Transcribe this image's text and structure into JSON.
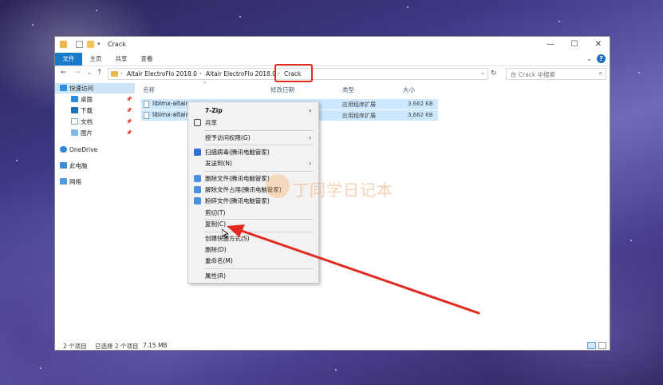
{
  "window": {
    "title": "Crack",
    "controls": {
      "minimize": "—",
      "maximize": "☐",
      "close": "✕"
    }
  },
  "ribbon": {
    "tabs": [
      "文件",
      "主页",
      "共享",
      "查看"
    ],
    "collapse_icon": "chevron-down-icon",
    "help_label": "?"
  },
  "address": {
    "crumbs": [
      "Altair ElectroFlo 2018.0",
      "Altair ElectroFlo 2018.0",
      "Crack"
    ],
    "search_placeholder": "在 Crack 中搜索"
  },
  "nav": {
    "items": [
      {
        "label": "快速访问",
        "icon": "star-icon",
        "pinned": false
      },
      {
        "label": "桌面",
        "icon": "desktop-icon",
        "pinned": true
      },
      {
        "label": "下载",
        "icon": "download-icon",
        "pinned": true
      },
      {
        "label": "文档",
        "icon": "document-icon",
        "pinned": true
      },
      {
        "label": "图片",
        "icon": "picture-icon",
        "pinned": true
      },
      {
        "label": "OneDrive",
        "icon": "cloud-icon",
        "pinned": false
      },
      {
        "label": "此电脑",
        "icon": "computer-icon",
        "pinned": false
      },
      {
        "label": "网络",
        "icon": "network-icon",
        "pinned": false
      }
    ]
  },
  "columns": {
    "name": "名称",
    "modified": "修改日期",
    "type": "类型",
    "size": "大小"
  },
  "files": [
    {
      "name": "liblmx-altair...",
      "type": "应用程序扩展",
      "size": "3,662 KB"
    },
    {
      "name": "liblmx-altair...",
      "type": "应用程序扩展",
      "size": "3,662 KB"
    }
  ],
  "context_menu": {
    "items": [
      {
        "label": "7-Zip",
        "bold": true,
        "submenu": true
      },
      {
        "label": "共享",
        "icon": "share-icon"
      },
      {
        "label": "授予访问权限(G)",
        "submenu": true
      },
      {
        "label": "扫描病毒(腾讯电脑管家)",
        "icon": "shield-icon"
      },
      {
        "label": "发送到(N)",
        "submenu": true
      },
      {
        "label": "删除文件(腾讯电脑管家)",
        "icon": "delete-file-icon"
      },
      {
        "label": "解除文件占用(腾讯电脑管家)",
        "icon": "unlock-file-icon"
      },
      {
        "label": "粉碎文件(腾讯电脑管家)",
        "icon": "shred-file-icon"
      },
      {
        "label": "剪切(T)"
      },
      {
        "label": "复制(C)"
      },
      {
        "label": "创建快捷方式(S)"
      },
      {
        "label": "删除(D)"
      },
      {
        "label": "重命名(M)"
      },
      {
        "label": "属性(R)"
      }
    ]
  },
  "status": {
    "count": "2 个项目",
    "selected": "已选择 2 个项目",
    "size": "7.15 MB"
  },
  "watermark": {
    "text": "丁同学日记本",
    "icon": "cat-logo-icon"
  },
  "colors": {
    "accent": "#1979ca",
    "selection": "#cce8ff",
    "annotation_red": "#e02a20"
  }
}
